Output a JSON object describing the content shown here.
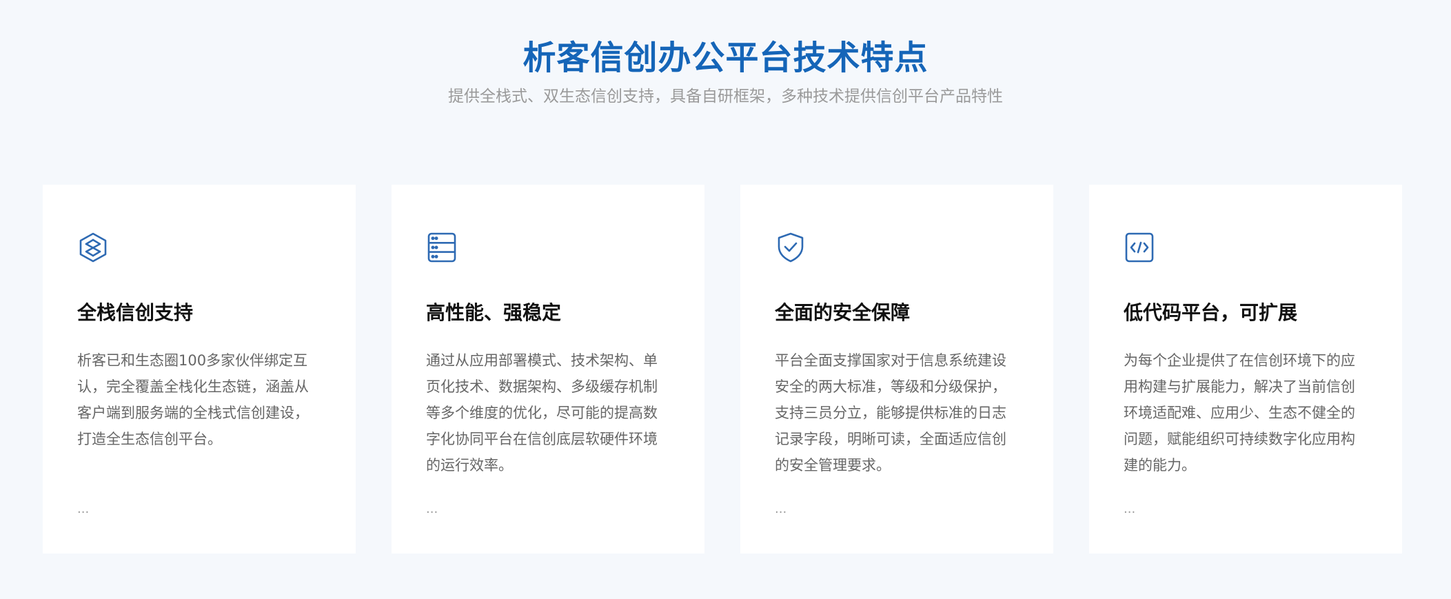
{
  "header": {
    "title": "析客信创办公平台技术特点",
    "subtitle": "提供全栈式、双生态信创支持，具备自研框架，多种技术提供信创平台产品特性"
  },
  "colors": {
    "accent": "#1565b8",
    "icon": "#2e6ab3",
    "background": "#f5f8fc"
  },
  "cards": [
    {
      "icon": "layers-cube-icon",
      "title": "全栈信创支持",
      "description": "析客已和生态圈100多家伙伴绑定互认，完全覆盖全栈化生态链，涵盖从客户端到服务端的全栈式信创建设，打造全生态信创平台。",
      "more": "..."
    },
    {
      "icon": "server-icon",
      "title": "高性能、强稳定",
      "description": "通过从应用部署模式、技术架构、单页化技术、数据架构、多级缓存机制等多个维度的优化，尽可能的提高数字化协同平台在信创底层软硬件环境的运行效率。",
      "more": "..."
    },
    {
      "icon": "shield-check-icon",
      "title": "全面的安全保障",
      "description": "平台全面支撑国家对于信息系统建设安全的两大标准，等级和分级保护，支持三员分立，能够提供标准的日志记录字段，明晰可读，全面适应信创的安全管理要求。",
      "more": "..."
    },
    {
      "icon": "code-icon",
      "title": "低代码平台，可扩展",
      "description": "为每个企业提供了在信创环境下的应用构建与扩展能力，解决了当前信创环境适配难、应用少、生态不健全的问题，赋能组织可持续数字化应用构建的能力。",
      "more": "..."
    }
  ]
}
